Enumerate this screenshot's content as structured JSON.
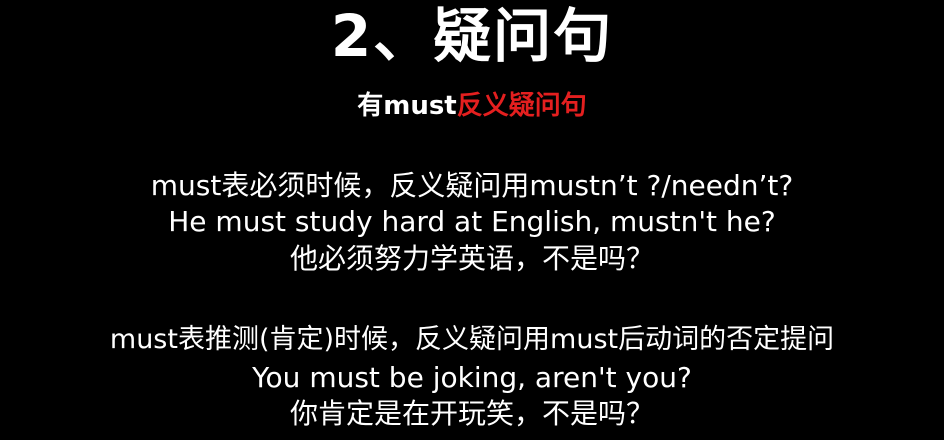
{
  "slide": {
    "title": "2、疑问句",
    "subtitle": {
      "prefix": "有must",
      "highlight": "反义疑问句"
    },
    "section1": {
      "rule": "must表必须时候，反义疑问用mustn’t ?/needn’t?",
      "example_en": "He must study hard at English, mustn't he?",
      "example_zh": "他必须努力学英语，不是吗？"
    },
    "section2": {
      "rule": "must表推测(肯定)时候，反义疑问用must后动词的否定提问",
      "example_en": "You must be joking, aren't you?",
      "example_zh": "你肯定是在开玩笑，不是吗？"
    },
    "colors": {
      "background": "#000000",
      "text": "#ffffff",
      "accent": "#e41f1f"
    }
  }
}
